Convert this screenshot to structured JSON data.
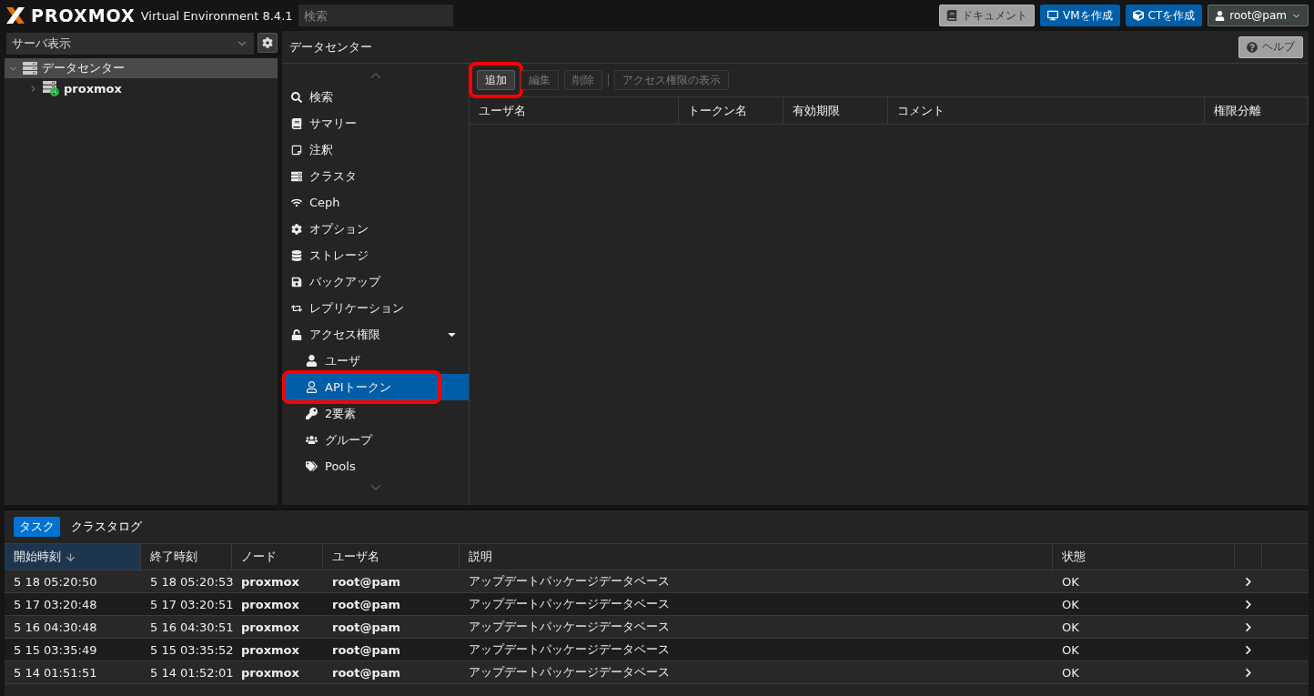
{
  "header": {
    "brand": "PROXMOX",
    "product": "Virtual Environment 8.4.1",
    "search": {
      "placeholder": "検索"
    },
    "buttons": [
      {
        "label": "ドキュメント",
        "kind": "plain"
      },
      {
        "label": "VMを作成",
        "kind": "primary"
      },
      {
        "label": "CTを作成",
        "kind": "primary"
      }
    ],
    "user": "root@pam"
  },
  "sidebar": {
    "view": "サーバ表示",
    "tree": [
      {
        "label": "データセンター",
        "expanded": true,
        "selected": true,
        "children": [
          {
            "label": "proxmox",
            "expanded": false,
            "selected": false
          }
        ]
      }
    ]
  },
  "content": {
    "title": "データセンター",
    "help": "ヘルプ"
  },
  "nav": [
    {
      "label": "検索",
      "selected": false
    },
    {
      "label": "サマリー",
      "selected": false
    },
    {
      "label": "注釈",
      "selected": false
    },
    {
      "label": "クラスタ",
      "selected": false
    },
    {
      "label": "Ceph",
      "selected": false
    },
    {
      "label": "オプション",
      "selected": false
    },
    {
      "label": "ストレージ",
      "selected": false
    },
    {
      "label": "バックアップ",
      "selected": false
    },
    {
      "label": "レプリケーション",
      "selected": false
    },
    {
      "label": "アクセス権限",
      "selected": false,
      "expanded": true,
      "children": [
        {
          "label": "ユーザ",
          "selected": false,
          "highlighted": false
        },
        {
          "label": "APIトークン",
          "selected": true,
          "highlighted": true
        },
        {
          "label": "2要素",
          "selected": false,
          "highlighted": false
        },
        {
          "label": "グループ",
          "selected": false,
          "highlighted": false
        },
        {
          "label": "Pools",
          "selected": false,
          "highlighted": false
        }
      ]
    }
  ],
  "toolbar": [
    {
      "label": "追加",
      "disabled": false,
      "highlighted": true
    },
    {
      "label": "編集",
      "disabled": true,
      "highlighted": false
    },
    {
      "label": "削除",
      "disabled": true,
      "highlighted": false
    },
    {
      "label": "アクセス権限の表示",
      "disabled": true,
      "highlighted": false
    }
  ],
  "token_table": {
    "columns": [
      "ユーザ名",
      "トークン名",
      "有効期限",
      "コメント",
      "権限分離"
    ]
  },
  "bottom": {
    "tabs": [
      {
        "label": "タスク",
        "selected": true
      },
      {
        "label": "クラスタログ",
        "selected": false
      }
    ],
    "columns": [
      {
        "label": "開始時刻",
        "sorted": true
      },
      {
        "label": "終了時刻",
        "sorted": false
      },
      {
        "label": "ノード",
        "sorted": false
      },
      {
        "label": "ユーザ名",
        "sorted": false
      },
      {
        "label": "説明",
        "sorted": false
      },
      {
        "label": "状態",
        "sorted": false
      }
    ],
    "rows": [
      [
        "5 18 05:20:50",
        "5 18 05:20:53",
        "proxmox",
        "root@pam",
        "アップデートパッケージデータベース",
        "OK"
      ],
      [
        "5 17 03:20:48",
        "5 17 03:20:51",
        "proxmox",
        "root@pam",
        "アップデートパッケージデータベース",
        "OK"
      ],
      [
        "5 16 04:30:48",
        "5 16 04:30:51",
        "proxmox",
        "root@pam",
        "アップデートパッケージデータベース",
        "OK"
      ],
      [
        "5 15 03:35:49",
        "5 15 03:35:52",
        "proxmox",
        "root@pam",
        "アップデートパッケージデータベース",
        "OK"
      ],
      [
        "5 14 01:51:51",
        "5 14 01:52:01",
        "proxmox",
        "root@pam",
        "アップデートパッケージデータベース",
        "OK"
      ]
    ]
  }
}
